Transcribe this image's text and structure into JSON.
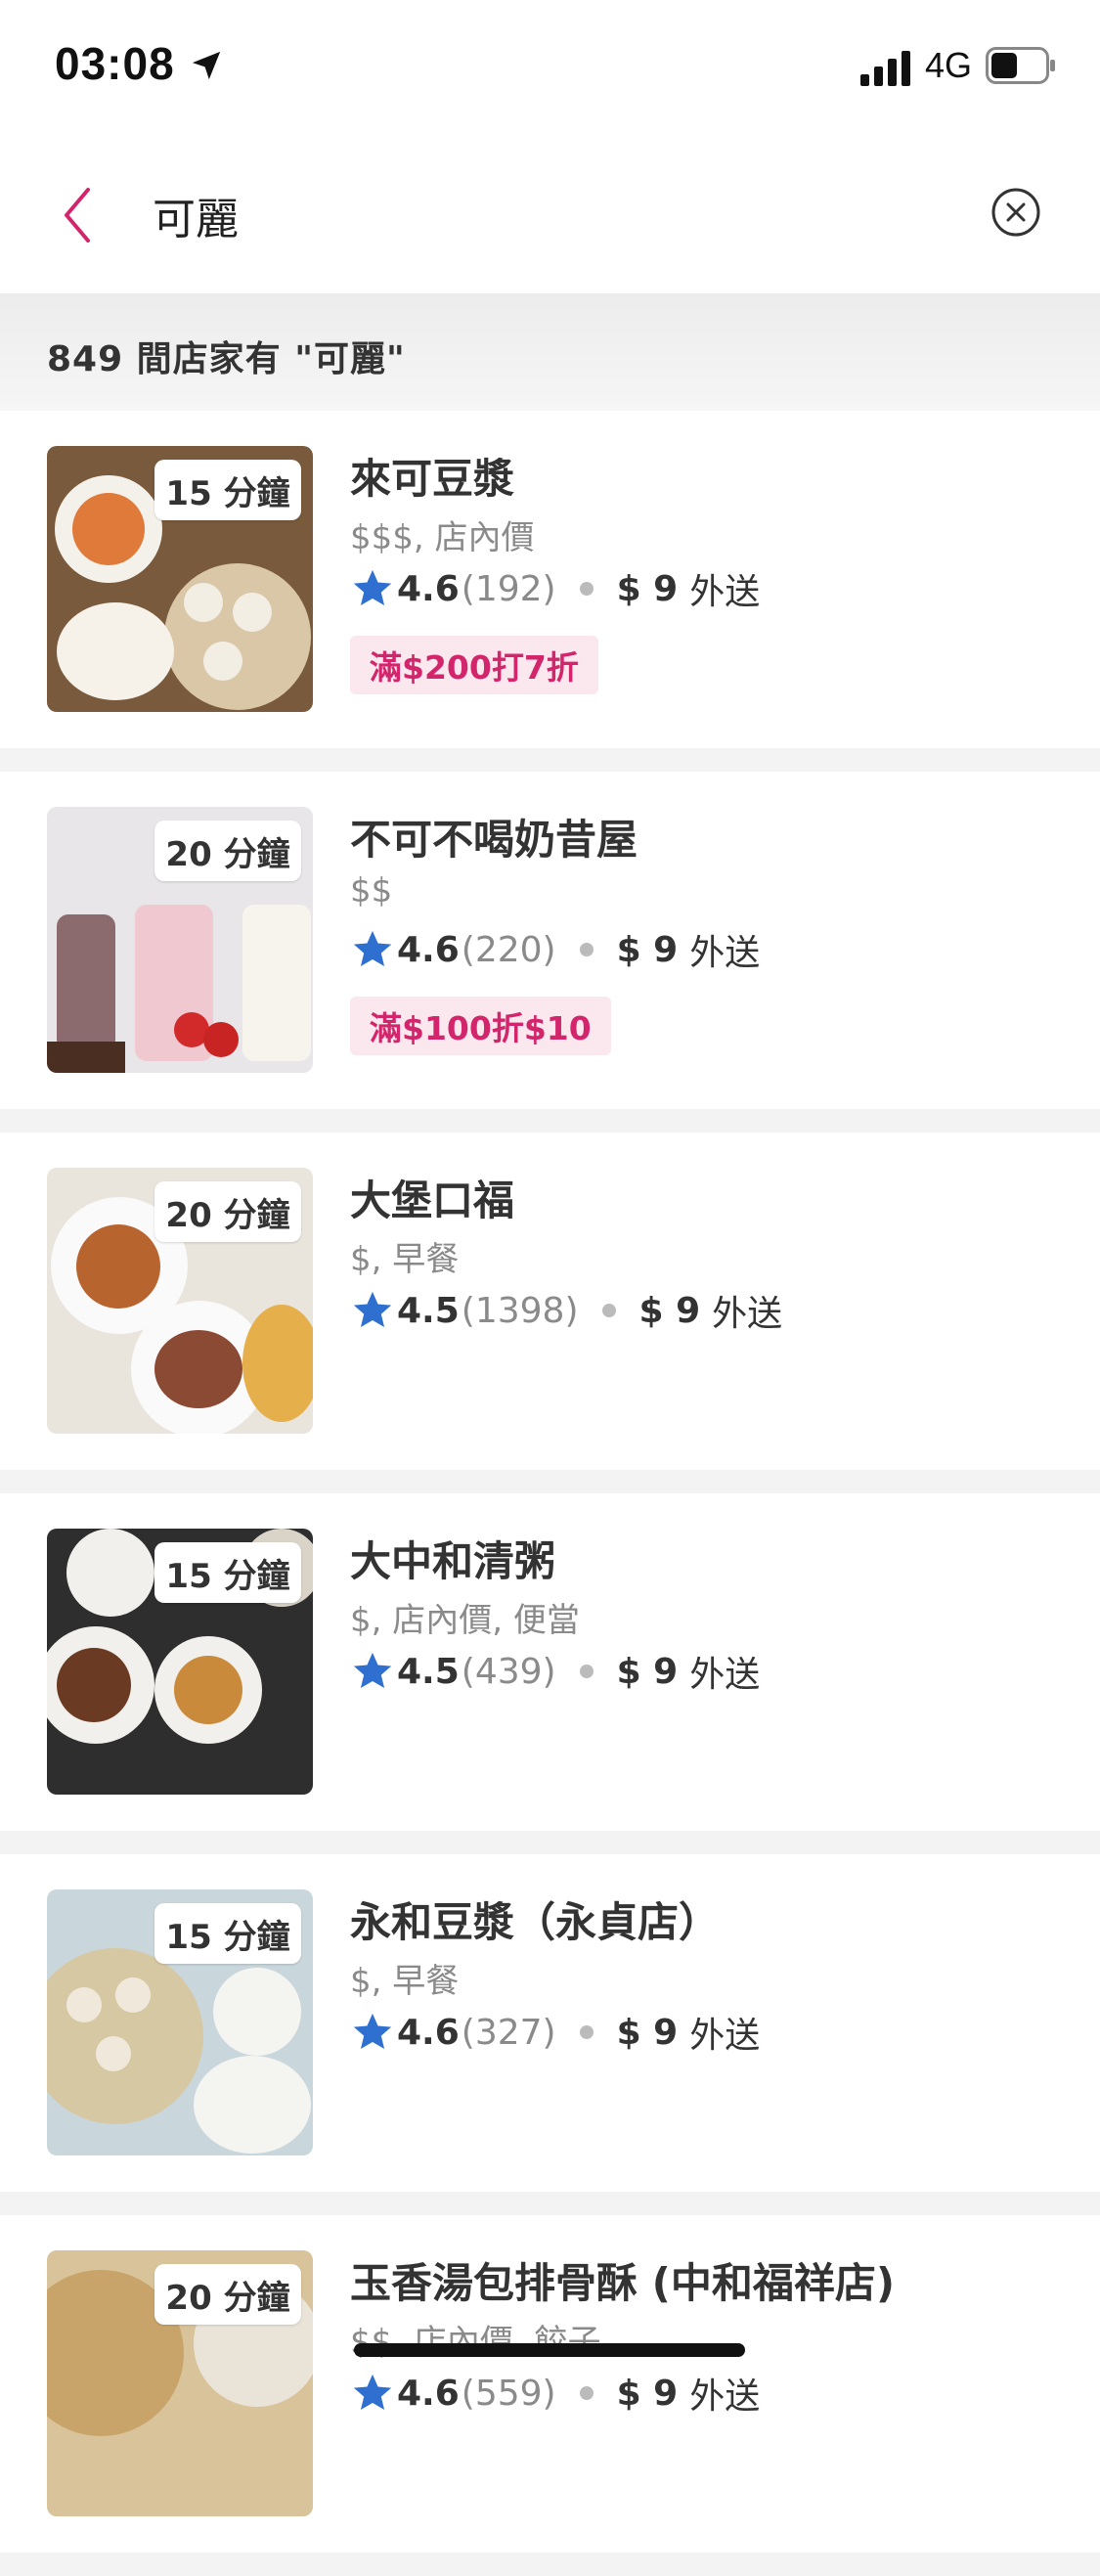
{
  "status": {
    "time": "03:08",
    "network": "4G"
  },
  "search": {
    "query": "可麗"
  },
  "results": {
    "count_text": "849 間店家有 \"可麗\""
  },
  "restaurants": [
    {
      "time": "15 分鐘",
      "name": "來可豆漿",
      "tags": "$$$, 店內價",
      "rating": "4.6",
      "reviews": "(192)",
      "fee": "$ 9",
      "fee_label": "外送",
      "promo": "滿$200打7折"
    },
    {
      "time": "20 分鐘",
      "name": "不可不喝奶昔屋",
      "tags": "$$",
      "rating": "4.6",
      "reviews": "(220)",
      "fee": "$ 9",
      "fee_label": "外送",
      "promo": "滿$100折$10"
    },
    {
      "time": "20 分鐘",
      "name": "大堡口福",
      "tags": "$, 早餐",
      "rating": "4.5",
      "reviews": "(1398)",
      "fee": "$ 9",
      "fee_label": "外送"
    },
    {
      "time": "15 分鐘",
      "name": "大中和清粥",
      "tags": "$, 店內價, 便當",
      "rating": "4.5",
      "reviews": "(439)",
      "fee": "$ 9",
      "fee_label": "外送"
    },
    {
      "time": "15 分鐘",
      "name": "永和豆漿（永貞店）",
      "tags": "$, 早餐",
      "rating": "4.6",
      "reviews": "(327)",
      "fee": "$ 9",
      "fee_label": "外送"
    },
    {
      "time": "20 分鐘",
      "name": "玉香湯包排骨酥 (中和福祥店)",
      "tags": "$$, 店內價, 餃子",
      "rating": "4.6",
      "reviews": "(559)",
      "fee": "$ 9",
      "fee_label": "外送"
    }
  ],
  "colors": {
    "accent": "#d3256b",
    "star": "#2f6fcf",
    "promo_bg": "#fbe7ee"
  },
  "icons": [
    "location-arrow-icon",
    "signal-icon",
    "battery-icon",
    "back-chevron-icon",
    "clear-icon",
    "star-icon"
  ]
}
